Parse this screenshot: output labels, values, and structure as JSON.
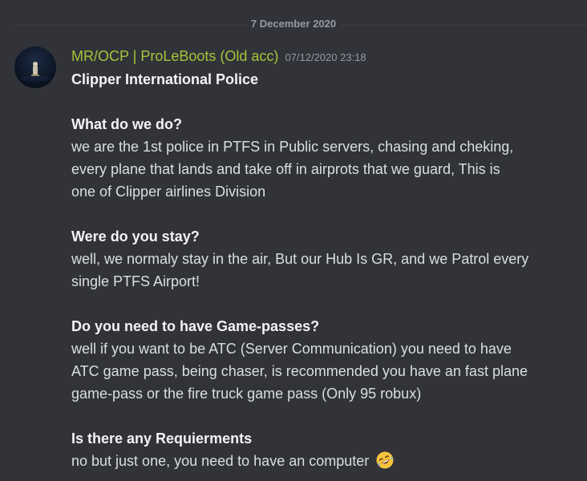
{
  "date_divider": "7 December 2020",
  "message": {
    "author": "MR/OCP | ProLeBoots (Old acc)",
    "timestamp": "07/12/2020 23:18",
    "title": "Clipper International Police",
    "q1": "What do we do?",
    "a1_l1": "we are the 1st police in PTFS in Public servers, chasing and cheking,",
    "a1_l2": "every plane that lands and take off in airprots that we guard, This is",
    "a1_l3": "one of Clipper airlines Division",
    "q2": "Were do you stay?",
    "a2_l1": "well, we normaly stay in the air, But our Hub Is GR, and we Patrol every",
    "a2_l2": "single PTFS Airport!",
    "q3": "Do you need to have Game-passes?",
    "a3_l1": "well if you want to be ATC (Server Communication) you need to have",
    "a3_l2": "ATC game pass, being chaser, is recommended you have an fast plane",
    "a3_l3": "game-pass or the fire truck game pass (Only 95 robux)",
    "q4": "Is there any Requierments",
    "a4_l1": "no but just one, you need to have an computer",
    "emoji": "rolling-on-the-floor-laughing"
  },
  "colors": {
    "background": "#313338",
    "author": "#a7c33b",
    "text": "#dbdee1",
    "muted": "#949ba4"
  }
}
